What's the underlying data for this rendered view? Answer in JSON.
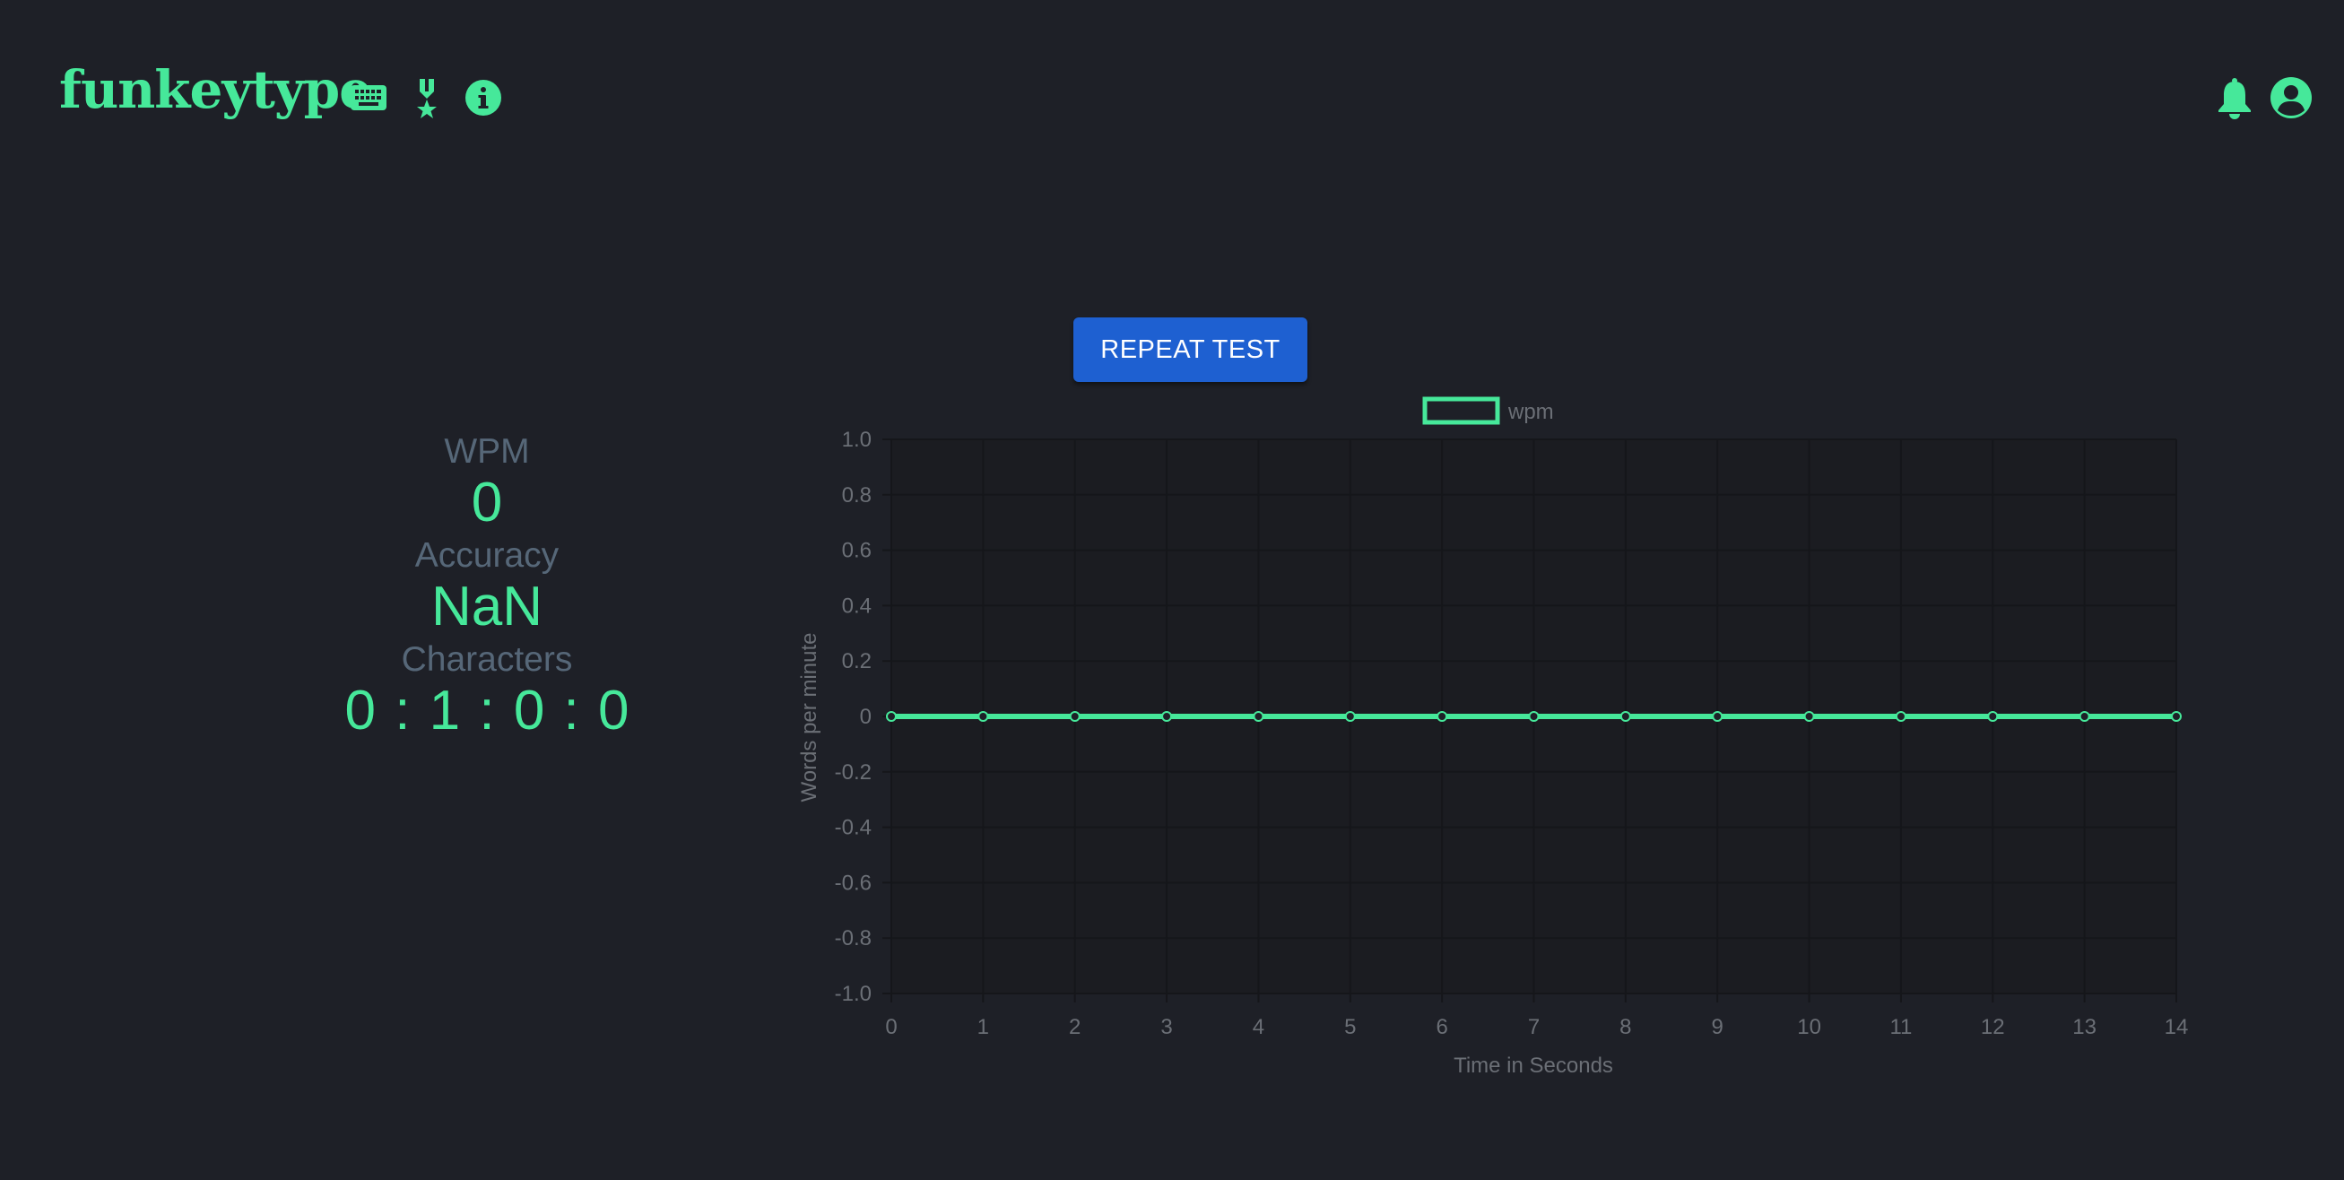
{
  "header": {
    "logo": "funkeytype",
    "icons": [
      "keyboard-icon",
      "award-icon",
      "info-icon",
      "bell-icon",
      "user-circle-icon"
    ]
  },
  "actions": {
    "repeat_label": "REPEAT TEST"
  },
  "stats": {
    "wpm_label": "WPM",
    "wpm_value": "0",
    "accuracy_label": "Accuracy",
    "accuracy_value": "NaN",
    "characters_label": "Characters",
    "characters_value": "0 : 1 : 0 : 0"
  },
  "colors": {
    "background": "#1e2027",
    "accent": "#46e89a",
    "button": "#1e60d1",
    "label": "#566778",
    "chart_text": "#6b6f76"
  },
  "chart_data": {
    "type": "line",
    "xlabel": "Time in Seconds",
    "ylabel": "Words per minute",
    "x": [
      0,
      1,
      2,
      3,
      4,
      5,
      6,
      7,
      8,
      9,
      10,
      11,
      12,
      13,
      14
    ],
    "xlim": [
      0,
      14
    ],
    "ylim": [
      -1.0,
      1.0
    ],
    "yticks": [
      "1.0",
      "0.8",
      "0.6",
      "0.4",
      "0.2",
      "0",
      "-0.2",
      "-0.4",
      "-0.6",
      "-0.8",
      "-1.0"
    ],
    "legend": "top-center",
    "grid": true,
    "series": [
      {
        "name": "wpm",
        "values": [
          0,
          0,
          0,
          0,
          0,
          0,
          0,
          0,
          0,
          0,
          0,
          0,
          0,
          0,
          0
        ],
        "color": "#46e89a"
      }
    ]
  }
}
